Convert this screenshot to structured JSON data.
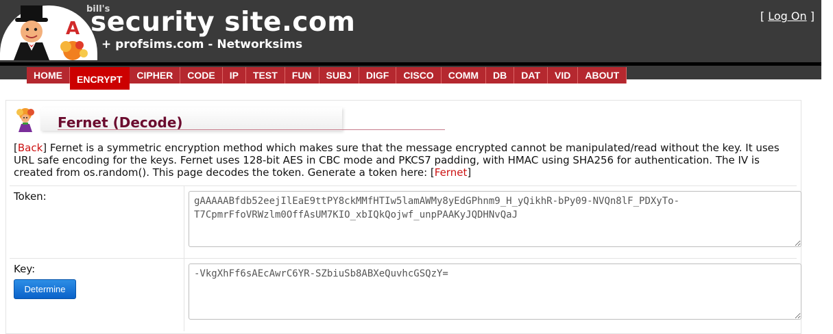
{
  "brand": {
    "small": "bill's",
    "title": "security site.com",
    "subtitle": "+ profsims.com - Networksims"
  },
  "login": {
    "open_bracket": "[",
    "label": "Log On",
    "close_bracket": "]"
  },
  "nav": {
    "items": [
      "HOME",
      "ENCRYPT",
      "CIPHER",
      "CODE",
      "IP",
      "TEST",
      "FUN",
      "SUBJ",
      "DIGF",
      "CISCO",
      "COMM",
      "DB",
      "DAT",
      "VID",
      "ABOUT"
    ],
    "active": "ENCRYPT"
  },
  "page": {
    "title": "Fernet (Decode)",
    "intro": {
      "open_bracket": "[",
      "back_link": "Back",
      "text": "] Fernet is a symmetric encryption method which makes sure that the message encrypted cannot be manipulated/read without the key. It uses URL safe encoding for the keys. Fernet uses 128-bit AES in CBC mode and PKCS7 padding, with HMAC using SHA256 for authentication. The IV is created from os.random(). This page decodes the token. Generate a token here: [",
      "fernet_link": "Fernet",
      "close_bracket": "]"
    }
  },
  "form": {
    "token_label": "Token:",
    "token_value": "gAAAAABfdb52eejIlEaE9ttPY8ckMMfHTIw5lamAWMy8yEdGPhnm9_H_yQikhR-bPy09-NVQn8lF_PDXyTo-T7CpmrFfoVRWzlm0OffAsUM7KIO_xbIQkQojwf_unpPAAKyJQDHNvQaJ",
    "key_label": "Key:",
    "key_value": "-VkgXhFf6sAEcAwrC6YR-SZbiuSb8ABXeQuvhcGSQzY=",
    "determine_label": "Determine"
  },
  "colors": {
    "header_bg": "#3a3a3a",
    "nav_bg": "#b5282f",
    "nav_active": "#cc0000",
    "title_color": "#6b0b2e",
    "link_color": "#cc1111",
    "button_blue": "#0a62c9"
  },
  "icons": [
    "logo-mascot-icon",
    "security-mascot-icon"
  ]
}
